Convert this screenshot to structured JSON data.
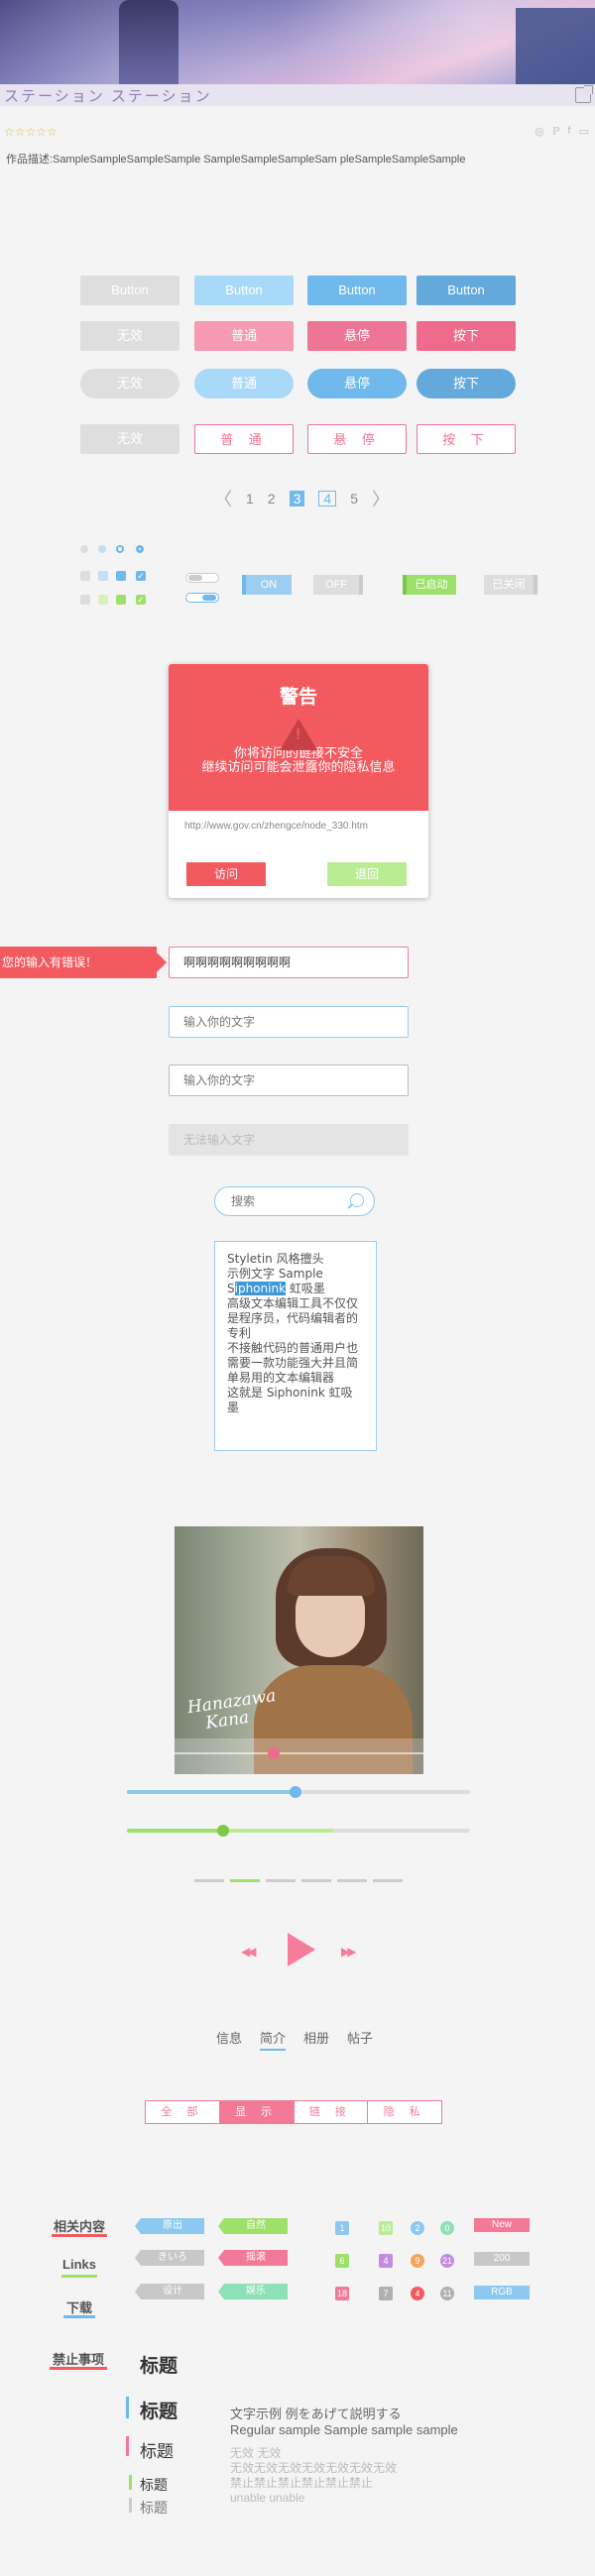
{
  "header": {
    "title": "ステーション ステーション",
    "rating_stars": "☆☆☆☆☆",
    "description": "作品描述:SampleSampleSampleSample SampleSampleSampleSam pleSampleSampleSample"
  },
  "buttons": {
    "row1": [
      "Button",
      "Button",
      "Button",
      "Button"
    ],
    "row2": [
      "无效",
      "普通",
      "悬停",
      "按下"
    ],
    "row3": [
      "无效",
      "普通",
      "悬停",
      "按下"
    ],
    "row4": [
      "无效",
      "普 通",
      "悬 停",
      "按 下"
    ]
  },
  "pagination": {
    "pages": [
      "1",
      "2",
      "3",
      "4",
      "5"
    ],
    "current": "3",
    "prev": "〈",
    "next": "〉"
  },
  "switches": {
    "on": "ON",
    "off": "OFF",
    "enabled": "已启动",
    "disabled": "已关闭"
  },
  "alert": {
    "title": "警告",
    "icon": "!",
    "message_line1": "你将访问的链接不安全",
    "message_line2": "继续访问可能会泄露你的隐私信息",
    "url": "http://www.gov.cn/zhengce/node_330.htm",
    "visit": "访问",
    "back": "退回"
  },
  "form": {
    "error_tip": "您的输入有错误！",
    "error_value": "啊啊啊啊啊啊啊啊啊",
    "placeholder": "输入你的文字",
    "disabled_placeholder": "无法输入文字",
    "search_placeholder": "搜索"
  },
  "editor": {
    "line1": "Styletin 风格擅头",
    "line2": "示例文字 Sample",
    "line3a": "S",
    "line3hl": "iphonink",
    "line3b": " 虹吸墨",
    "line4": "高级文本编辑工具不仅仅是程序员，代码编辑者的专利",
    "line5": "不接触代码的普通用户也需要一款功能强大并且简单易用的文本编辑器",
    "line6": "这就是 Siphonink 虹吸墨"
  },
  "media": {
    "signature_line1": "Hanazawa",
    "signature_line2": "Kana",
    "progress_blue": 0.49,
    "progress_green": 0.28,
    "photo_progress": 0.4
  },
  "tabs": [
    "信息",
    "简介",
    "相册",
    "帖子"
  ],
  "segment": [
    "全 部",
    "显 示",
    "链 接",
    "隐 私"
  ],
  "labels": {
    "left": [
      "相关内容",
      "Links",
      "下载",
      "禁止事项"
    ],
    "tags": [
      "原出",
      "自然",
      "きいろ",
      "摇滚",
      "设计",
      "娱乐"
    ],
    "grid": [
      [
        "1",
        "10",
        "2",
        "0",
        "New"
      ],
      [
        "6",
        "4",
        "9",
        "21",
        "200"
      ],
      [
        "18",
        "7",
        "4",
        "11",
        "RGB"
      ]
    ]
  },
  "headings": {
    "h": [
      "标题",
      "标题",
      "标题",
      "标题",
      "标题"
    ]
  },
  "sample_text": {
    "line1": "文字示例 例をあげて説明する",
    "line2": "Regular sample Sample sample sample",
    "dis1": "无效 无效",
    "dis2": "无效无效无效无效无效无效无效",
    "dis3": "禁止禁止禁止禁止禁止禁止",
    "dis4": "unable unable"
  },
  "colors": {
    "accent_pink": "#ef7594",
    "accent_blue": "#6fb9ec",
    "accent_green": "#9de06a",
    "alert_red": "#f35a60"
  }
}
